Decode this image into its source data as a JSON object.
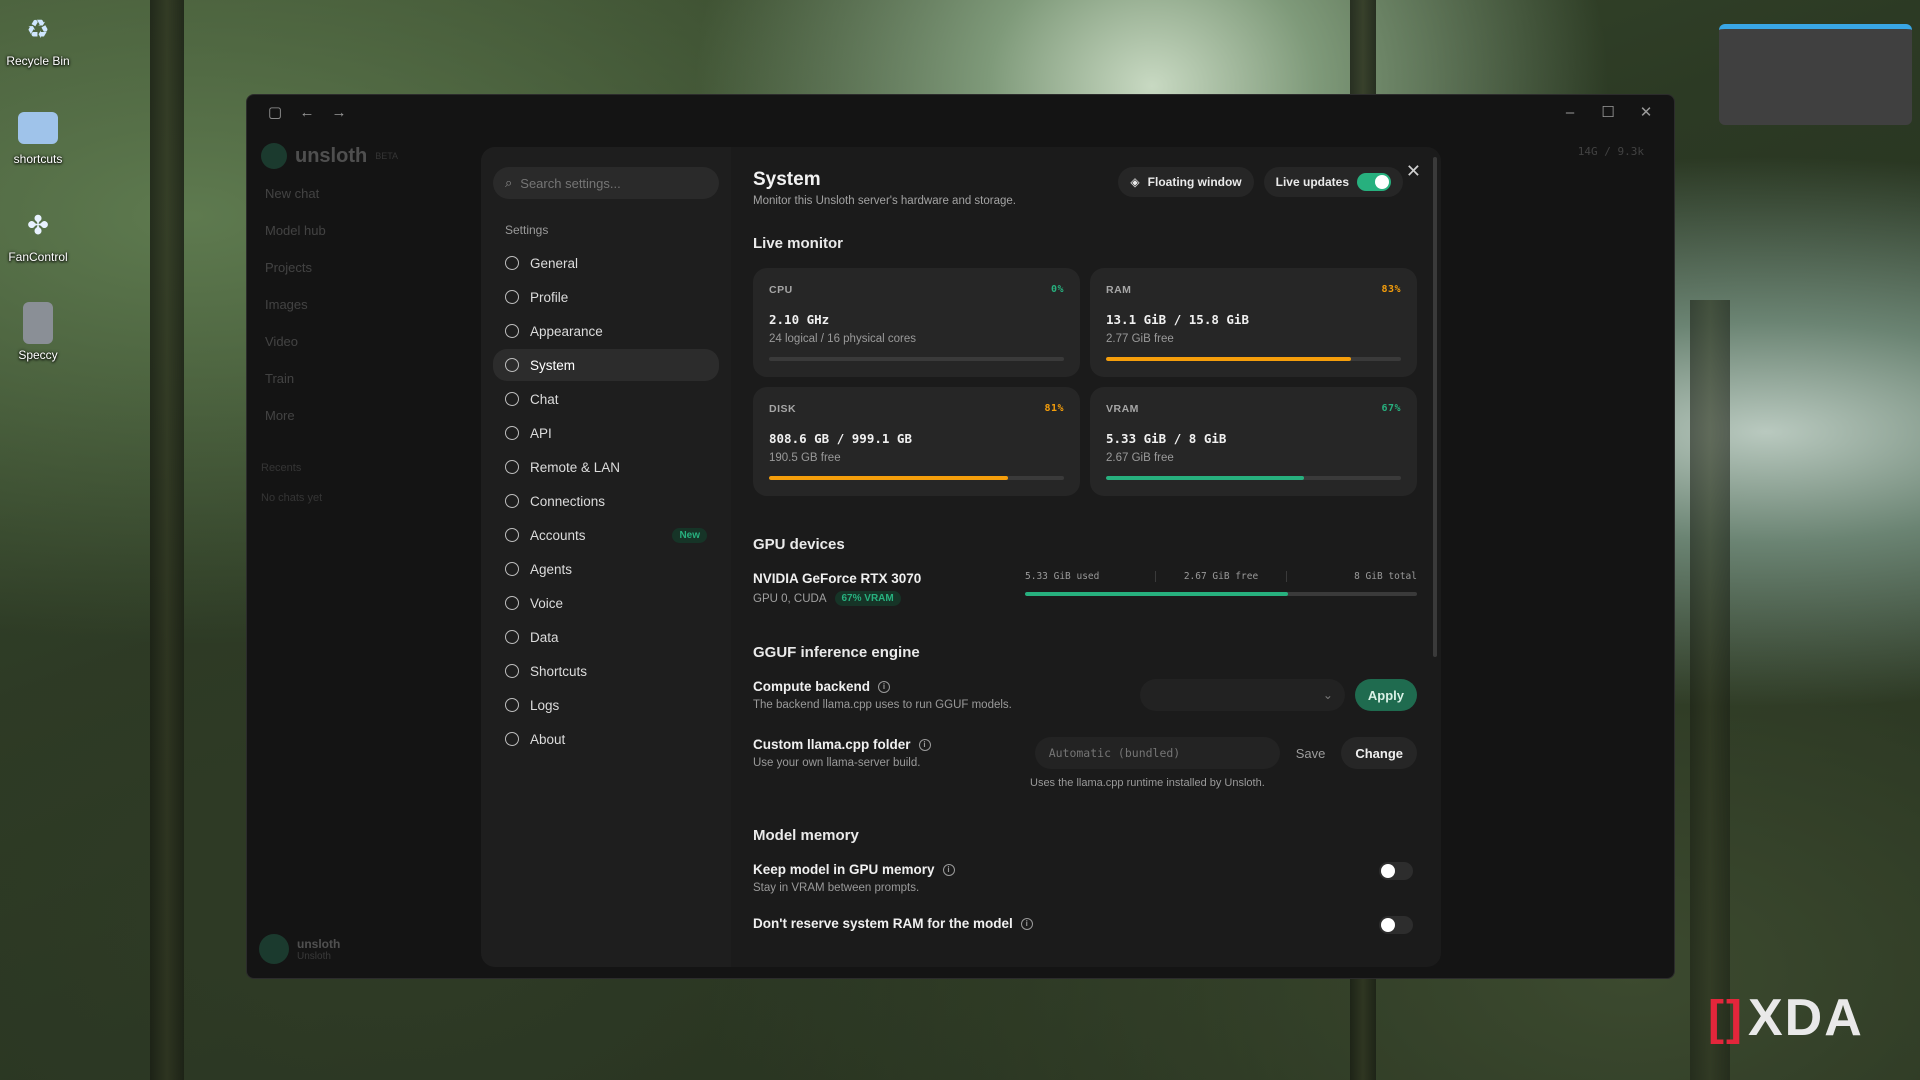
{
  "desktop": {
    "icons": [
      {
        "label": "Recycle Bin",
        "icon": "recycle-bin-icon"
      },
      {
        "label": "shortcuts",
        "icon": "folder-icon"
      },
      {
        "label": "FanControl",
        "icon": "fan-icon"
      },
      {
        "label": "Speccy",
        "icon": "speccy-icon"
      }
    ],
    "watermark": "XDA"
  },
  "app": {
    "brand": "unsloth",
    "brand_tag": "BETA",
    "nav": [
      "New chat",
      "Model hub",
      "Projects",
      "Images",
      "Video",
      "Train",
      "More"
    ],
    "recents_label": "Recents",
    "recents_empty": "No chats yet",
    "user_name": "unsloth",
    "user_sub": "Unsloth",
    "top_stats": "14G / 9.3k"
  },
  "settings": {
    "search_placeholder": "Search settings...",
    "heading": "Settings",
    "nav": [
      {
        "label": "General",
        "active": false
      },
      {
        "label": "Profile",
        "active": false
      },
      {
        "label": "Appearance",
        "active": false
      },
      {
        "label": "System",
        "active": true
      },
      {
        "label": "Chat",
        "active": false
      },
      {
        "label": "API",
        "active": false
      },
      {
        "label": "Remote & LAN",
        "active": false
      },
      {
        "label": "Connections",
        "active": false
      },
      {
        "label": "Accounts",
        "active": false,
        "badge": "New"
      },
      {
        "label": "Agents",
        "active": false
      },
      {
        "label": "Voice",
        "active": false
      },
      {
        "label": "Data",
        "active": false
      },
      {
        "label": "Shortcuts",
        "active": false
      },
      {
        "label": "Logs",
        "active": false
      },
      {
        "label": "About",
        "active": false
      }
    ]
  },
  "system": {
    "title": "System",
    "subtitle": "Monitor this Unsloth server's hardware and storage.",
    "floating_window": "Floating window",
    "live_updates": "Live updates",
    "live_updates_on": true,
    "live_monitor_title": "Live monitor",
    "monitor": {
      "cpu": {
        "label": "CPU",
        "pct": "0%",
        "value": "2.10 GHz",
        "sub": "24 logical / 16 physical cores",
        "fraction": 0.0,
        "color": "#27b07e"
      },
      "ram": {
        "label": "RAM",
        "pct": "83%",
        "value": "13.1 GiB / 15.8 GiB",
        "sub": "2.77 GiB free",
        "fraction": 0.83,
        "color": "#f59e0b"
      },
      "disk": {
        "label": "DISK",
        "pct": "81%",
        "value": "808.6 GB / 999.1 GB",
        "sub": "190.5 GB free",
        "fraction": 0.81,
        "color": "#f59e0b"
      },
      "vram": {
        "label": "VRAM",
        "pct": "67%",
        "value": "5.33 GiB / 8 GiB",
        "sub": "2.67 GiB free",
        "fraction": 0.67,
        "color": "#27b07e"
      }
    },
    "gpu_title": "GPU devices",
    "gpu": {
      "name": "NVIDIA GeForce RTX 3070",
      "sub": "GPU 0, CUDA",
      "badge": "67% VRAM",
      "used": "5.33 GiB used",
      "free": "2.67 GiB free",
      "total": "8 GiB total",
      "fraction": 0.67
    },
    "gguf_title": "GGUF inference engine",
    "compute_backend": {
      "label": "Compute backend",
      "desc": "The backend llama.cpp uses to run GGUF models.",
      "apply": "Apply"
    },
    "custom_folder": {
      "label": "Custom llama.cpp folder",
      "desc": "Use your own llama-server build.",
      "placeholder": "Automatic (bundled)",
      "save": "Save",
      "change": "Change",
      "note": "Uses the llama.cpp runtime installed by Unsloth."
    },
    "model_memory_title": "Model memory",
    "keep_gpu": {
      "label": "Keep model in GPU memory",
      "desc": "Stay in VRAM between prompts.",
      "on": false
    },
    "dont_reserve": {
      "label": "Don't reserve system RAM for the model",
      "on": false
    }
  },
  "colors": {
    "accent": "#27b07e",
    "warning": "#f59e0b"
  }
}
